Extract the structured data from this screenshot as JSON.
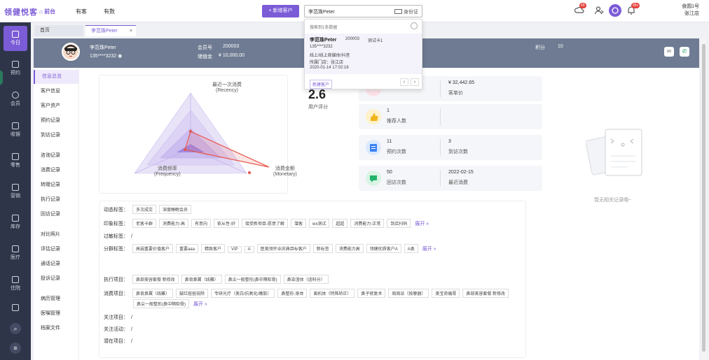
{
  "topbar": {
    "logo": "领健悦客",
    "nav": [
      "前台",
      "有客",
      "有数"
    ],
    "new_customer_btn": "+ 新增客户",
    "search_value": "李范珠Peter",
    "id_card_label": "身份证",
    "badges": [
      "40",
      "99+"
    ],
    "store_line1": "食圆1号",
    "store_line2": "张江店"
  },
  "rail": [
    {
      "label": "今日",
      "icon": "calendar-icon",
      "active": true
    },
    {
      "label": "预约",
      "icon": "calendar-check-icon"
    },
    {
      "label": "会员",
      "icon": "user-icon"
    },
    {
      "label": "收银",
      "icon": "cash-register-icon"
    },
    {
      "label": "零售",
      "icon": "bag-icon"
    },
    {
      "label": "营销",
      "icon": "megaphone-icon"
    },
    {
      "label": "库存",
      "icon": "box-icon"
    },
    {
      "label": "医疗",
      "icon": "medical-icon"
    },
    {
      "label": "住院",
      "icon": "bed-icon"
    }
  ],
  "tabs": {
    "home": "首页",
    "current": "李范珠Peter",
    "close": "×"
  },
  "customer": {
    "name": "李范珠Peter",
    "phone": "135****3232",
    "member_no_label": "会员号",
    "member_no": "200003",
    "balance_label": "储值金",
    "balance": "¥ 10,000.00",
    "points_label": "积分",
    "points": "10"
  },
  "side_menu": [
    "信息总览",
    "客户信息",
    "客户资产",
    "预约记录",
    "到访记录",
    "咨询记录",
    "消费记录",
    "转赠记录",
    "执行记录",
    "回访记录",
    "对比照片",
    "评估记录",
    "通话记录",
    "投诉记录",
    "病历管理",
    "医嘱管理",
    "档案文件"
  ],
  "radar": {
    "top_label": "最近一次消费",
    "top_sub": "(Recency)",
    "left_label": "消费频率",
    "left_sub": "(Frequency)",
    "right_label": "消费金额",
    "right_sub": "(Monetary)"
  },
  "score": {
    "value": "2.6",
    "label": "用户评分"
  },
  "stats": {
    "avg_price_value": "¥ 32,442.65",
    "avg_price_label": "客单价",
    "referrals_value": "1",
    "referrals_label": "推荐人数",
    "appointments_value": "11",
    "appointments_label": "预约次数",
    "visits_value": "3",
    "visits_label": "到访次数",
    "returns_value": "50",
    "returns_label": "回访次数",
    "last_consume_value": "2022-02-15",
    "last_consume_label": "最近消费"
  },
  "empty_text": "暂无相关记录哦~",
  "tags": {
    "dynamic_label": "动态标签：",
    "dynamic": [
      "多次成交",
      "深度睡眠会员"
    ],
    "impression_label": "印象标签：",
    "impression": [
      "老客卡群",
      "消费能力-高",
      "有意向",
      "依从性-好",
      "接受新项目-愿意了解",
      "潜客",
      "wx测试",
      "超超",
      "消费能力-正常",
      "到店扫码"
    ],
    "expand": "展开 »",
    "allergy_label": "过敏标签：",
    "allergy_value": "/",
    "group_label": "分群标签：",
    "group": [
      "高弱重要价值客户",
      "重要aaa",
      "精致客户",
      "VIP",
      "A",
      "医美领开业庆典目标客户",
      "新标签",
      "消费能力高",
      "领健优质客户A",
      "A类"
    ],
    "exec_label": "执行项目：",
    "exec": [
      "鼻部美容套餐 新修改",
      "鼻背鼻翼（线雕）",
      "鼻尖一般整形(鼻中隔软骨)",
      "鼻染渣体（适科分）"
    ],
    "consume_label": "消费项目：",
    "consume": [
      "鼻背鼻翼（线雕）",
      "鼓红痘痘祛除",
      "专研光疗（美白/抗氧化/嫩肤）",
      "鼻整形-身体",
      "离机体（特殊矫正）",
      "鼻子修复术",
      "周周派（按摩器）",
      "美宝奇痛膏",
      "鼻部美容套餐 新修改"
    ],
    "consume2": [
      "鼻尖一般整形(鼻中隔软骨)"
    ],
    "focus_project_label": "关注项目：",
    "focus_project_value": "/",
    "focus_activity_label": "关注活动：",
    "focus_activity_value": "/",
    "potential_label": "潜在项目：",
    "potential_value": "/"
  },
  "dropdown": {
    "header": "搜索到1条数据",
    "name": "李范珠Peter",
    "member_no": "200003",
    "card": "测试卡1",
    "phone": "135****3232",
    "source": "线上/线上商媒体/抖音",
    "store": "所属门店：张江店",
    "time": "2020-01-14 17:02:16",
    "new_btn": "新建客户",
    "prev": "‹",
    "next": "›"
  },
  "colors": {
    "accent": "#7b5cd6",
    "rail": "#2f3549",
    "band": "#6e7b92"
  }
}
